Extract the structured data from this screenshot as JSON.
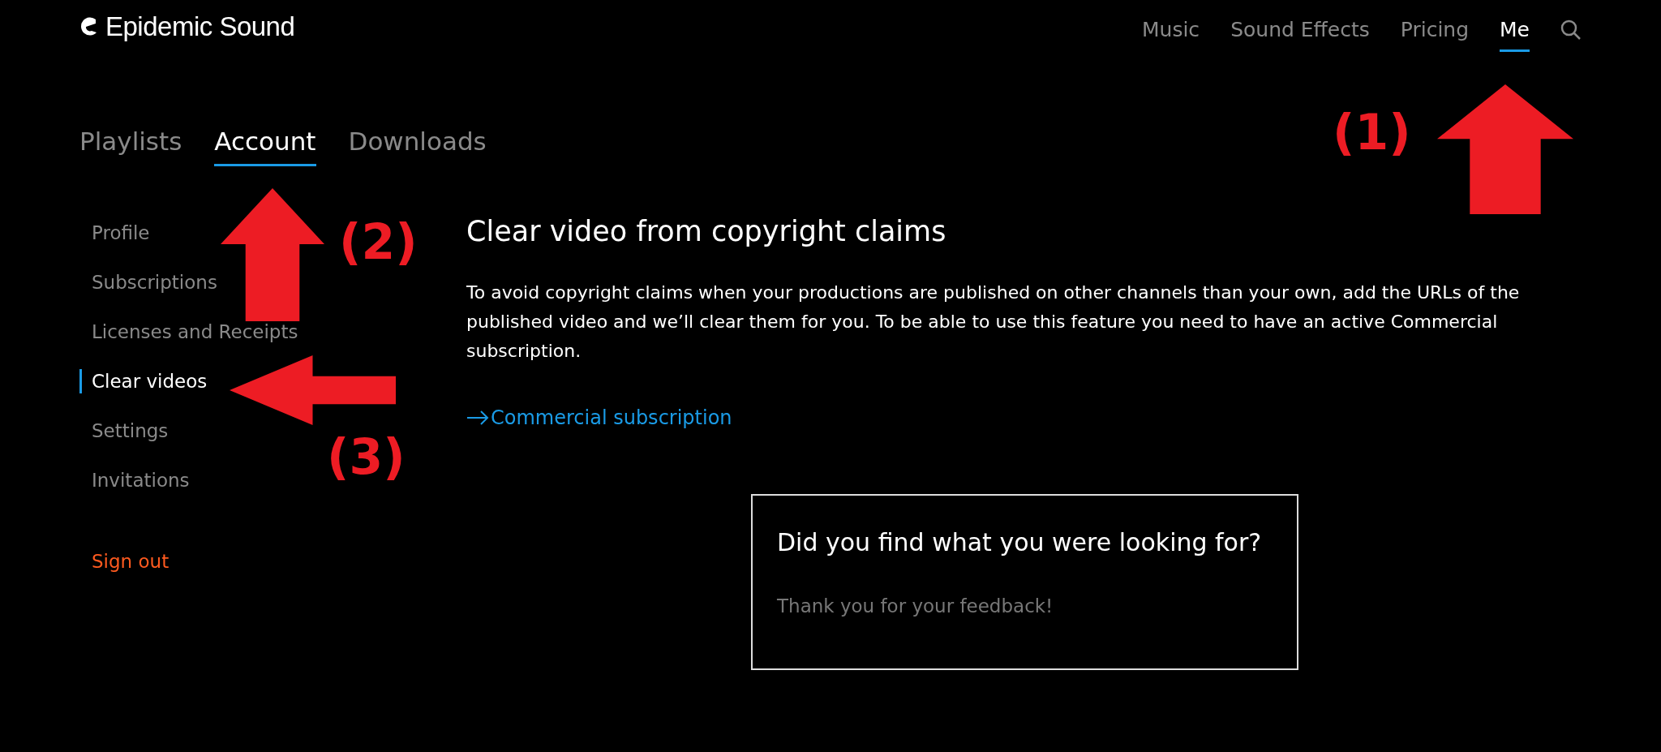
{
  "brand": {
    "name": "Epidemic Sound"
  },
  "top_nav": [
    {
      "label": "Music",
      "selected": false
    },
    {
      "label": "Sound Effects",
      "selected": false
    },
    {
      "label": "Pricing",
      "selected": false
    },
    {
      "label": "Me",
      "selected": true
    }
  ],
  "tabs": [
    {
      "label": "Playlists",
      "selected": false
    },
    {
      "label": "Account",
      "selected": true
    },
    {
      "label": "Downloads",
      "selected": false
    }
  ],
  "sidebar": {
    "items": [
      {
        "label": "Profile",
        "selected": false
      },
      {
        "label": "Subscriptions",
        "selected": false
      },
      {
        "label": "Licenses and Receipts",
        "selected": false
      },
      {
        "label": "Clear videos",
        "selected": true
      },
      {
        "label": "Settings",
        "selected": false
      },
      {
        "label": "Invitations",
        "selected": false
      }
    ],
    "sign_out": "Sign out"
  },
  "content": {
    "title": "Clear video from copyright claims",
    "body": "To avoid copyright claims when your productions are published on other channels than your own, add the URLs of the published video and we’ll clear them for you. To be able to use this feature you need to have an active Commercial subscription.",
    "link": "Commercial subscription"
  },
  "feedback": {
    "question": "Did you find what you were looking for?",
    "thanks": "Thank you for your feedback!"
  },
  "annotations": [
    {
      "label": "(1)",
      "kind": "up"
    },
    {
      "label": "(2)",
      "kind": "up"
    },
    {
      "label": "(3)",
      "kind": "left"
    }
  ]
}
